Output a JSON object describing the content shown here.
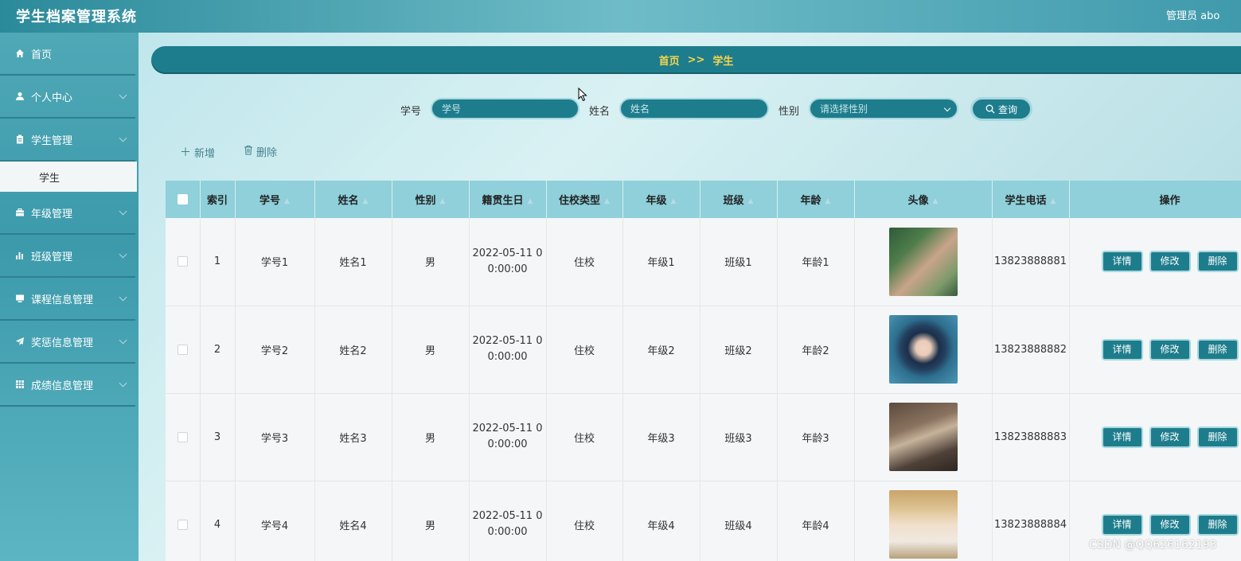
{
  "header": {
    "app_title": "学生档案管理系统",
    "user_label": "管理员 abo"
  },
  "sidebar": {
    "items": [
      {
        "label": "首页",
        "icon": "home-icon"
      },
      {
        "label": "个人中心",
        "icon": "user-icon"
      },
      {
        "label": "学生管理",
        "icon": "clipboard-icon"
      },
      {
        "label": "年级管理",
        "icon": "briefcase-icon"
      },
      {
        "label": "班级管理",
        "icon": "bar-chart-icon"
      },
      {
        "label": "课程信息管理",
        "icon": "monitor-icon"
      },
      {
        "label": "奖惩信息管理",
        "icon": "send-icon"
      },
      {
        "label": "成绩信息管理",
        "icon": "grid-icon"
      }
    ],
    "active_sub": "学生"
  },
  "breadcrumb": {
    "home": "首页",
    "separator": ">>",
    "current": "学生"
  },
  "search": {
    "student_no_label": "学号",
    "student_no_placeholder": "学号",
    "name_label": "姓名",
    "name_placeholder": "姓名",
    "gender_label": "性别",
    "gender_placeholder": "请选择性别",
    "query_label": "查询"
  },
  "toolbar": {
    "add_label": "新增",
    "delete_label": "删除"
  },
  "table": {
    "columns": [
      "索引",
      "学号",
      "姓名",
      "性别",
      "籍贯生日",
      "住校类型",
      "年级",
      "班级",
      "年龄",
      "头像",
      "学生电话",
      "操作"
    ],
    "rows": [
      {
        "index": "1",
        "student_no": "学号1",
        "name": "姓名1",
        "gender": "男",
        "date_1": "2022-05-11 0",
        "date_2": "0:00:00",
        "boarding": "住校",
        "grade": "年级1",
        "class": "班级1",
        "age": "年龄1",
        "phone": "13823888881"
      },
      {
        "index": "2",
        "student_no": "学号2",
        "name": "姓名2",
        "gender": "男",
        "date_1": "2022-05-11 0",
        "date_2": "0:00:00",
        "boarding": "住校",
        "grade": "年级2",
        "class": "班级2",
        "age": "年龄2",
        "phone": "13823888882"
      },
      {
        "index": "3",
        "student_no": "学号3",
        "name": "姓名3",
        "gender": "男",
        "date_1": "2022-05-11 0",
        "date_2": "0:00:00",
        "boarding": "住校",
        "grade": "年级3",
        "class": "班级3",
        "age": "年龄3",
        "phone": "13823888883"
      },
      {
        "index": "4",
        "student_no": "学号4",
        "name": "姓名4",
        "gender": "男",
        "date_1": "2022-05-11 0",
        "date_2": "0:00:00",
        "boarding": "住校",
        "grade": "年级4",
        "class": "班级4",
        "age": "年龄4",
        "phone": "13823888884"
      }
    ],
    "actions": {
      "detail": "详情",
      "edit": "修改",
      "delete": "删除"
    }
  },
  "watermark": "CSDN @QQ626162193",
  "colors": {
    "primary": "#1e7d8c",
    "header_bg": "#8fd0da",
    "breadcrumb_text": "#f7d44a"
  }
}
